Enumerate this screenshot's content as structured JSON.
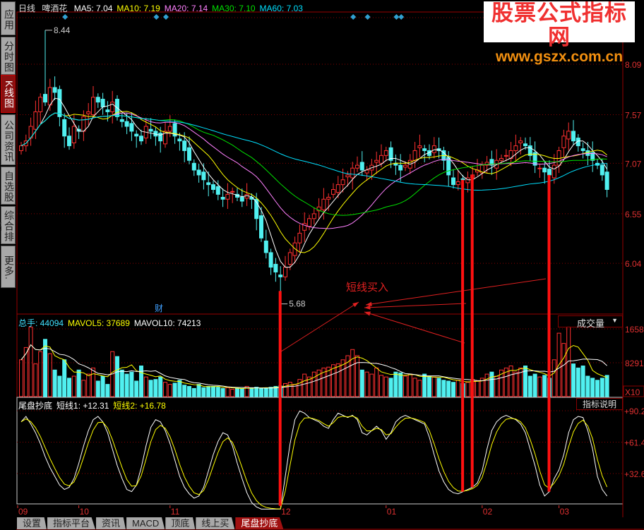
{
  "sidebar": [
    {
      "label": "应用"
    },
    {
      "label": "分时图"
    },
    {
      "label": "K线图",
      "active": true
    },
    {
      "label": "公司资讯"
    },
    {
      "label": "自选股"
    },
    {
      "label": "综合排名"
    },
    {
      "label": "更多."
    }
  ],
  "header": {
    "period": "日线",
    "stock": "啤酒花",
    "ma": [
      {
        "label": "MA5: 7.04",
        "color": "#ffffff"
      },
      {
        "label": "MA10: 7.19",
        "color": "#ffff00"
      },
      {
        "label": "MA20: 7.14",
        "color": "#ff80ff"
      },
      {
        "label": "MA30: 7.10",
        "color": "#00e000"
      },
      {
        "label": "MA60: 7.03",
        "color": "#00e0ff"
      }
    ]
  },
  "watermark": {
    "title": "股票公式指标网",
    "url": "www.gszx.com.cn"
  },
  "volume_header": {
    "items": [
      {
        "label": "总手: 44094",
        "color": "#40e0ff"
      },
      {
        "label": "MAVOL5: 37689",
        "color": "#ffff00"
      },
      {
        "label": "MAVOL10: 74213",
        "color": "#ffffff"
      }
    ],
    "selector": "成交量"
  },
  "indicator_header": {
    "items": [
      {
        "label": "尾盘抄底",
        "color": "#ffffff"
      },
      {
        "label": "短线1: +12.31",
        "color": "#ffffff"
      },
      {
        "label": "短线2: +16.78",
        "color": "#ffff00"
      }
    ],
    "explain": "指标说明"
  },
  "annotation": {
    "buy_text": "短线买入",
    "high_label": "8.44",
    "low_label": "5.68",
    "fin_label": "财"
  },
  "tabs": [
    {
      "label": "设置"
    },
    {
      "label": "指标平台"
    },
    {
      "label": "资讯"
    },
    {
      "label": "MACD"
    },
    {
      "label": "顶底"
    },
    {
      "label": "线上买"
    },
    {
      "label": "尾盘抄底",
      "active": true
    }
  ],
  "chart_data": {
    "type": "candlestick",
    "price_ticks": [
      "8.09",
      "7.57",
      "7.07",
      "6.55",
      "6.04"
    ],
    "price_tick_values": [
      8.09,
      7.57,
      7.07,
      6.55,
      6.04
    ],
    "volume_ticks": [
      "1658",
      "8291",
      "X10"
    ],
    "indicator_ticks": [
      "+90.2",
      "+61.4",
      "+32.6"
    ],
    "indicator_tick_values": [
      90.2,
      61.4,
      32.6
    ],
    "x_labels": [
      {
        "label": "09",
        "index": -1
      },
      {
        "label": "10",
        "index": 12
      },
      {
        "label": "11",
        "index": 31
      },
      {
        "label": "12",
        "index": 54
      },
      {
        "label": "01",
        "index": 76
      },
      {
        "label": "02",
        "index": 96
      },
      {
        "label": "03",
        "index": 112
      }
    ],
    "high_index": 5,
    "high_value": 8.44,
    "low_index": 54,
    "low_value": 5.68,
    "signal_markers": [
      9,
      28,
      30,
      69,
      72,
      78,
      79
    ],
    "buy_signals": [
      54,
      92,
      94,
      110
    ],
    "closes": [
      7.25,
      7.3,
      7.45,
      7.6,
      7.75,
      7.7,
      7.85,
      7.8,
      7.55,
      7.35,
      7.25,
      7.45,
      7.4,
      7.55,
      7.6,
      7.75,
      7.7,
      7.65,
      7.6,
      7.7,
      7.55,
      7.5,
      7.45,
      7.4,
      7.35,
      7.3,
      7.45,
      7.4,
      7.35,
      7.3,
      7.4,
      7.45,
      7.35,
      7.3,
      7.2,
      7.1,
      7.0,
      6.95,
      6.9,
      6.85,
      6.8,
      6.75,
      6.7,
      6.75,
      6.78,
      6.72,
      6.68,
      6.75,
      6.7,
      6.5,
      6.3,
      6.15,
      6.0,
      5.95,
      5.9,
      6.0,
      6.15,
      6.25,
      6.35,
      6.45,
      6.5,
      6.55,
      6.62,
      6.7,
      6.72,
      6.8,
      6.85,
      6.9,
      6.95,
      7.02,
      7.05,
      7.0,
      7.0,
      7.05,
      7.1,
      7.15,
      7.2,
      7.1,
      7.05,
      7.0,
      7.05,
      7.1,
      7.2,
      7.25,
      7.2,
      7.15,
      7.25,
      7.2,
      7.1,
      6.95,
      6.85,
      6.88,
      6.9,
      6.92,
      6.95,
      7.0,
      7.05,
      7.08,
      7.05,
      7.1,
      7.12,
      7.15,
      7.2,
      7.25,
      7.3,
      7.25,
      7.15,
      7.05,
      7.02,
      6.98,
      6.95,
      7.05,
      7.2,
      7.35,
      7.4,
      7.3,
      7.25,
      7.2,
      7.15,
      7.1,
      7.05,
      6.95,
      6.8
    ],
    "volumes": [
      900,
      1200,
      1700,
      800,
      1100,
      1400,
      1050,
      650,
      500,
      900,
      450,
      500,
      650,
      400,
      550,
      700,
      380,
      500,
      300,
      1100,
      980,
      650,
      550,
      600,
      380,
      750,
      480,
      400,
      420,
      480,
      350,
      300,
      330,
      400,
      280,
      250,
      200,
      300,
      220,
      250,
      250,
      230,
      200,
      220,
      180,
      200,
      190,
      250,
      200,
      230,
      200,
      210,
      230,
      250,
      260,
      320,
      350,
      300,
      420,
      550,
      480,
      600,
      650,
      700,
      720,
      780,
      800,
      900,
      1000,
      1150,
      1000,
      650,
      600,
      550,
      700,
      520,
      480,
      450,
      600,
      580,
      500,
      550,
      450,
      400,
      550,
      500,
      480,
      450,
      400,
      380,
      350,
      400,
      320,
      350,
      420,
      380,
      450,
      550,
      600,
      500,
      650,
      700,
      750,
      600,
      700,
      750,
      500,
      550,
      480,
      520,
      450,
      900,
      1550,
      1300,
      1700,
      800,
      700,
      750,
      500,
      450,
      400,
      450,
      520
    ],
    "short1": [
      80,
      85,
      78,
      70,
      60,
      48,
      38,
      30,
      22,
      18,
      20,
      28,
      42,
      58,
      72,
      82,
      85,
      80,
      70,
      55,
      40,
      28,
      18,
      16,
      22,
      38,
      58,
      75,
      82,
      80,
      72,
      60,
      45,
      30,
      20,
      14,
      10,
      12,
      20,
      35,
      50,
      62,
      70,
      68,
      58,
      42,
      28,
      15,
      6,
      2,
      0,
      0,
      0,
      0,
      0,
      30,
      60,
      82,
      90,
      88,
      84,
      82,
      80,
      76,
      74,
      82,
      88,
      86,
      84,
      86,
      82,
      70,
      68,
      72,
      76,
      72,
      64,
      70,
      80,
      84,
      86,
      84,
      82,
      80,
      78,
      66,
      50,
      35,
      25,
      18,
      15,
      14,
      16,
      18,
      20,
      24,
      35,
      55,
      72,
      80,
      84,
      86,
      84,
      82,
      78,
      70,
      55,
      40,
      22,
      12,
      16,
      28,
      36,
      50,
      70,
      82,
      85,
      84,
      72,
      55,
      30,
      18,
      12
    ]
  }
}
